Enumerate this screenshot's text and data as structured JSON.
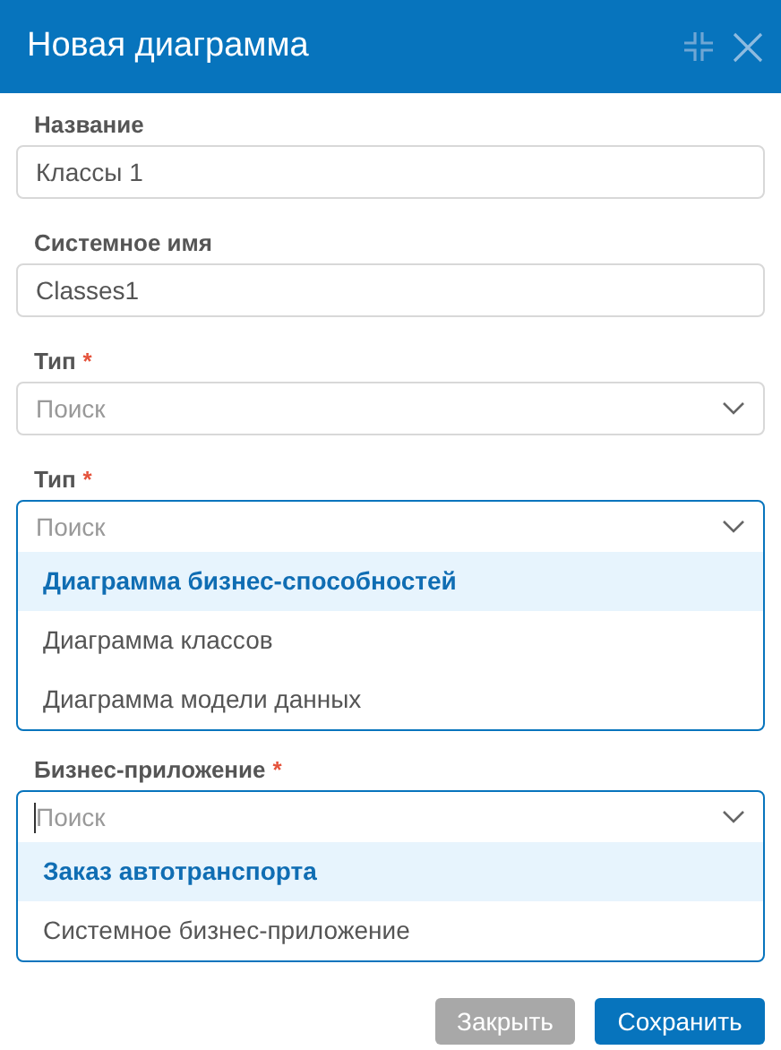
{
  "window": {
    "title": "Новая диаграмма"
  },
  "fields": [
    {
      "kind": "text",
      "label": "Название",
      "value": "Классы 1"
    },
    {
      "kind": "text",
      "label": "Системное имя",
      "value": "Classes1"
    },
    {
      "kind": "select",
      "label": "Тип",
      "required_mark": "*",
      "placeholder": "Поиск",
      "open": false,
      "focused": false
    },
    {
      "kind": "select",
      "label": "Тип",
      "required_mark": "*",
      "placeholder": "Поиск",
      "open": true,
      "focused": false,
      "options": [
        {
          "label": "Диаграмма бизнес-способностей",
          "selected": true
        },
        {
          "label": "Диаграмма классов",
          "selected": false
        },
        {
          "label": "Диаграмма модели данных",
          "selected": false
        }
      ]
    },
    {
      "kind": "select",
      "label": "Бизнес-приложение",
      "required_mark": "*",
      "placeholder": "Поиск",
      "open": true,
      "focused": true,
      "options": [
        {
          "label": "Заказ автотранспорта",
          "selected": true
        },
        {
          "label": "Системное бизнес-приложение",
          "selected": false
        }
      ]
    }
  ],
  "buttons": [
    {
      "kind": "secondary",
      "label": "Закрыть"
    },
    {
      "kind": "primary",
      "label": "Сохранить"
    }
  ]
}
